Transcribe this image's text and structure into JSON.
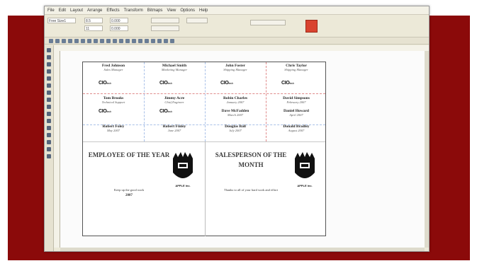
{
  "menu": [
    "File",
    "Edit",
    "Layout",
    "Arrange",
    "Effects",
    "Transform",
    "Bitmaps",
    "View",
    "Options",
    "Help"
  ],
  "property_bar": {
    "page_size": "Free Size1",
    "width": "8.5",
    "height": "11",
    "x_pos": "0.000",
    "y_pos": "0.000"
  },
  "cards": [
    {
      "name": "Fred Johnson",
      "title": "Sales Manager"
    },
    {
      "name": "Michael Smith",
      "title": "Marketing Manager"
    },
    {
      "name": "John Foster",
      "title": "Shipping Manager"
    },
    {
      "name": "Chris Taylor",
      "title": "Shipping Manager"
    },
    {
      "name": "Tom Brooks",
      "title": "Technical Support"
    },
    {
      "name": "Jimmy Acre",
      "title": "Chief Engineer"
    },
    {
      "name": "Robin Charles",
      "title": "January 2007"
    },
    {
      "name": "David Simpsons",
      "title": "February 2007"
    },
    {
      "name": "Robert Foley",
      "title": "May 2007"
    },
    {
      "name": "Robert Finley",
      "title": "June 2007"
    },
    {
      "name": "Dave McFadden",
      "title": "March 2007"
    },
    {
      "name": "Daniel Howard",
      "title": "April 2007"
    },
    {
      "name": "Douglas Ball",
      "title": "July 2007"
    },
    {
      "name": "Donald Bradley",
      "title": "August 2007"
    }
  ],
  "logo_text": "CIO",
  "logo_small": "tech",
  "awards": [
    {
      "heading": "EMPLOYEE OF THE YEAR",
      "sub": "Keep up the good work",
      "year": "2007",
      "crest": "APPLE inc."
    },
    {
      "heading": "SALESPERSON OF THE MONTH",
      "sub": "Thanks to all of your hard work and effort",
      "year": "",
      "crest": "APPLE inc."
    }
  ],
  "colors": {
    "frame": "#8b0a0a",
    "accent_button": "#d9432f",
    "window": "#ece9d8"
  }
}
